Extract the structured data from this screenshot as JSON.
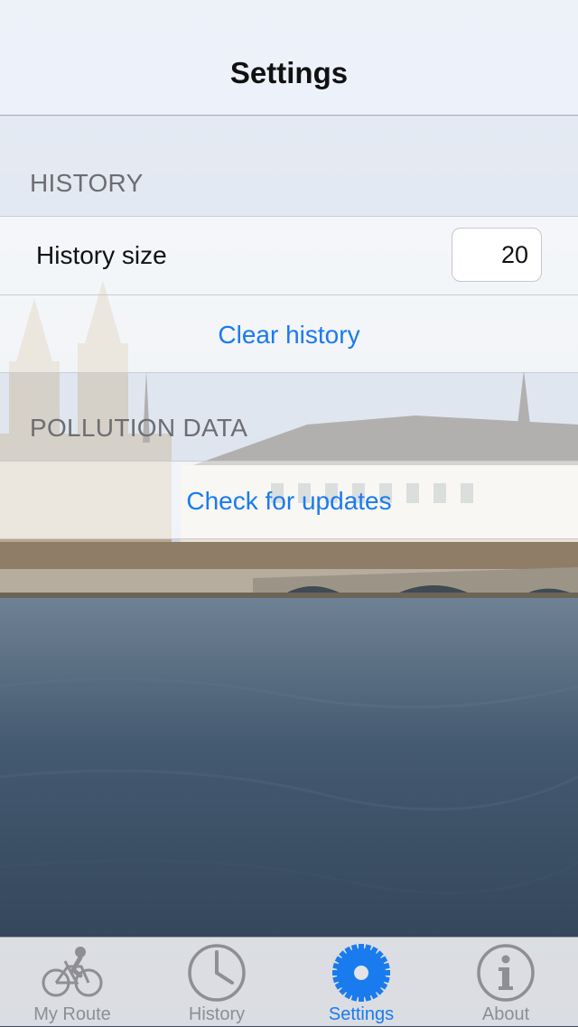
{
  "navbar": {
    "title": "Settings"
  },
  "sections": {
    "history": {
      "header": "HISTORY",
      "size_label": "History size",
      "size_value": "20",
      "clear_label": "Clear history"
    },
    "pollution": {
      "header": "POLLUTION DATA",
      "update_label": "Check for updates"
    }
  },
  "tabbar": {
    "items": [
      {
        "label": "My Route",
        "icon": "bicycle-icon"
      },
      {
        "label": "History",
        "icon": "clock-icon"
      },
      {
        "label": "Settings",
        "icon": "gear-icon"
      },
      {
        "label": "About",
        "icon": "info-icon"
      }
    ],
    "active_index": 2
  },
  "colors": {
    "accent": "#1a7bee",
    "inactive": "#8e8e93",
    "section_header": "#6d6d72"
  }
}
